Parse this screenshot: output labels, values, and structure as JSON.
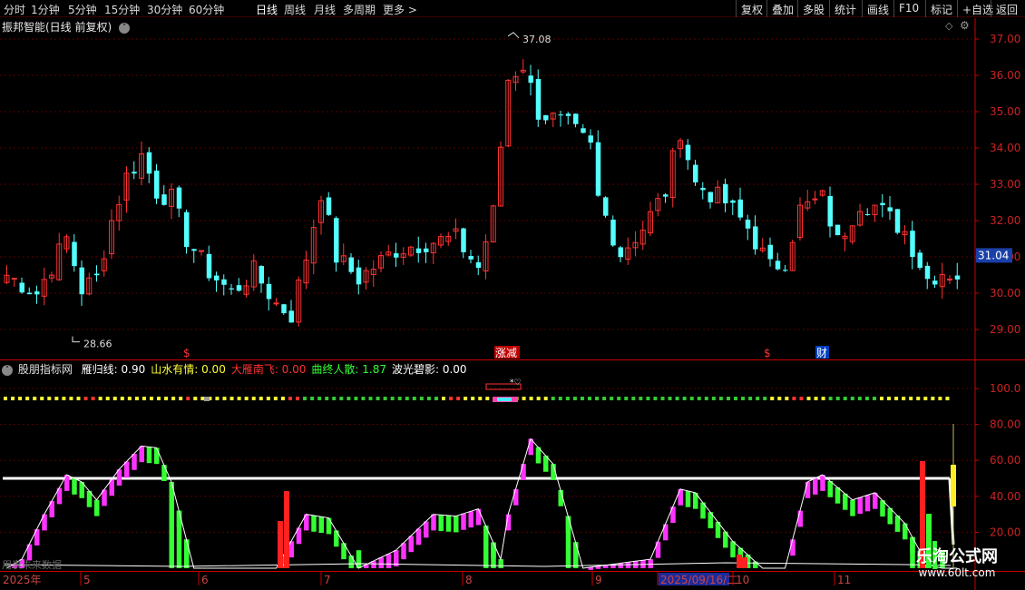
{
  "periods": [
    "分时",
    "1分钟",
    "5分钟",
    "15分钟",
    "30分钟",
    "60分钟",
    "日线",
    "周线",
    "月线",
    "多周期",
    "更多 >"
  ],
  "active_period": "日线",
  "tools": [
    "复权",
    "叠加",
    "多股",
    "统计",
    "画线",
    "F10",
    "标记",
    "+自选",
    "返回"
  ],
  "stock_title": "振邦智能(日线 前复权)",
  "price_axis": [
    "37.00",
    "36.00",
    "35.00",
    "34.00",
    "33.00",
    "32.00",
    "31.00",
    "30.00",
    "29.00"
  ],
  "current_price": "31.04",
  "high_label": "37.08",
  "low_label": "28.66",
  "events": [
    {
      "text": "$",
      "color": "#ff3333"
    },
    {
      "text": "涨减",
      "color": "#ffffff",
      "bg": "#c00000"
    },
    {
      "text": "$",
      "color": "#ff3333"
    },
    {
      "text": "财",
      "color": "#ffffff",
      "bg": "#0040c0"
    }
  ],
  "indicator": {
    "name": "股朋指标网",
    "values": [
      {
        "label": "雁归线: 0.90",
        "color": "#ffffff"
      },
      {
        "label": "山水有情: 0.00",
        "color": "#ffff33"
      },
      {
        "label": "大雁南飞: 0.00",
        "color": "#ff3333"
      },
      {
        "label": "曲终人散: 1.87",
        "color": "#33ff33"
      },
      {
        "label": "波光碧影: 0.00",
        "color": "#ffffff"
      }
    ],
    "axis": [
      "100.0",
      "80.00",
      "60.00",
      "40.00",
      "20.00"
    ],
    "note_text": "用表未来数据"
  },
  "date_axis": [
    "2025年",
    "5",
    "6",
    "7",
    "8",
    "9",
    "2025/09/16/二",
    "10",
    "11"
  ],
  "watermark": {
    "title": "乐淘公式网",
    "url": "www.60lt.com"
  },
  "colors": {
    "up": "#ff3232",
    "down": "#54ffff",
    "magenta": "#ff33ff",
    "green": "#33ff33",
    "grid": "#5a0000",
    "axis": "#cc0000"
  }
}
